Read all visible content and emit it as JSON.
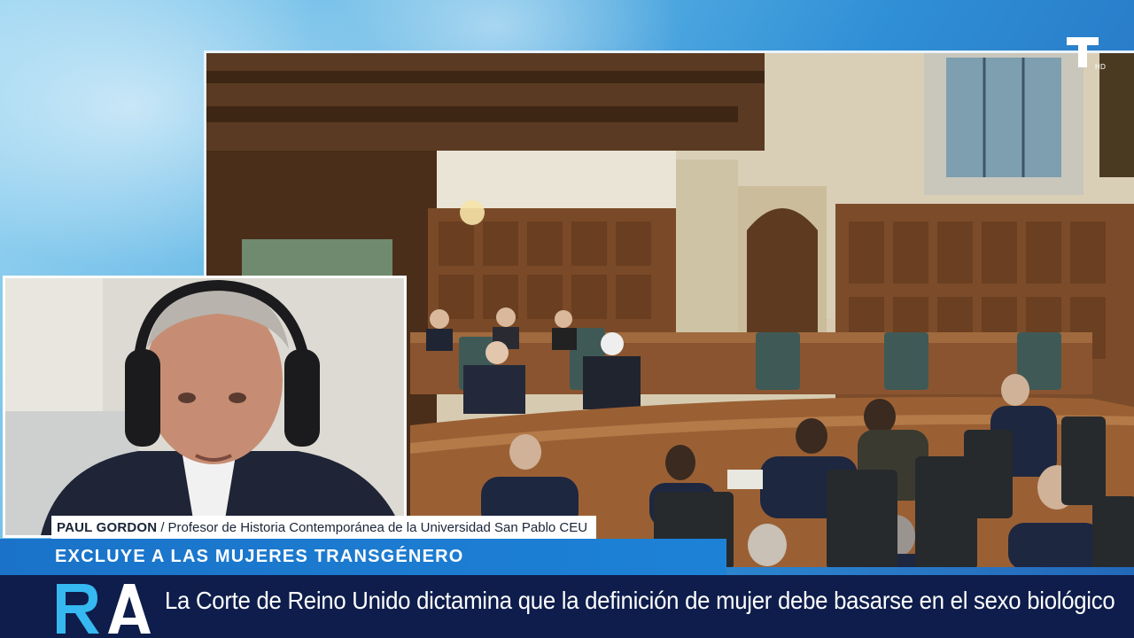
{
  "lower_third": {
    "guest_name": "PAUL GORDON",
    "separator": "/",
    "guest_title": "Profesor de Historia Contemporánea de la Universidad San Pablo CEU",
    "topic": "EXCLUYE A LAS MUJERES TRANSGÉNERO",
    "headline": "La Corte de Reino Unido dictamina que la definición de mujer debe basarse en el sexo biológico"
  },
  "branding": {
    "channel_bug_letter": "T",
    "channel_bug_sub": "HD",
    "program_logo": "RA"
  },
  "colors": {
    "topic_bar": "#1a73c9",
    "headline_bar": "#0e1d4b",
    "logo_cyan": "#35b9f0",
    "logo_white": "#ffffff"
  }
}
